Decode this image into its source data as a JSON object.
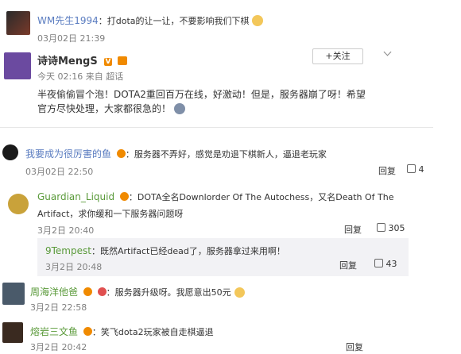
{
  "c1": {
    "name": "WM先生1994",
    "text": "：打dota的让一让，不要影响我们下棋",
    "time": "03月02日 21:39"
  },
  "post": {
    "name": "诗诗MengS",
    "vbadge": "V",
    "follow": "+关注",
    "time": "今天 02:16 来自 超话",
    "line1": "半夜偷偷冒个泡！DOTA2重回百万在线，好激动！但是，服务器崩了呀！希望",
    "line2": "官方尽快处理，大家都很急的！"
  },
  "c2": {
    "name": "我要成为很厉害的鱼",
    "text": "：服务器不弄好，感觉是劝退下棋新人，逼退老玩家",
    "time": "03月02日 22:50",
    "reply": "回复",
    "likes": "4"
  },
  "c3": {
    "name": "Guardian_Liquid",
    "line1": "：DOTA全名Downlorder Of The Autochess，又名Death Of The",
    "line2": "Artifact，求你缓和一下服务器问题呀",
    "time": "3月2日 20:40",
    "reply": "回复",
    "likes": "305"
  },
  "c3r": {
    "name": "9Tempest",
    "text": "：既然Artifact已经dead了，服务器拿过来用啊！",
    "time": "3月2日 20:48",
    "reply": "回复",
    "likes": "43"
  },
  "c4": {
    "name": "周海洋他爸",
    "text": "：服务器升级呀。我愿意出50元",
    "time": "3月2日 22:58"
  },
  "c5": {
    "name": "熔岩三文鱼",
    "text": "：笑飞dota2玩家被自走棋逼退",
    "time": "3月2日 20:42",
    "reply": "回复"
  },
  "colors": {
    "accent": "#eb7350",
    "link": "#5a7cc0",
    "reply_bg": "#f2f2f5"
  }
}
